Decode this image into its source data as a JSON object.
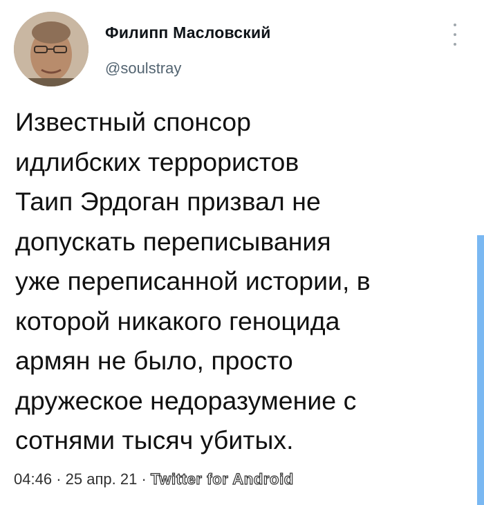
{
  "tweet": {
    "author_name": "Филипп Масловский",
    "author_handle": "@soulstray",
    "text_lines": [
      "Известный спонсор",
      "идлибских террористов",
      "Таип Эрдоган призвал не",
      "допускать переписывания",
      "уже переписанной истории, в",
      "которой никакого геноцида",
      "армян не было, просто",
      "дружеское недоразумение с",
      "сотнями тысяч убитых."
    ],
    "time": "04:46",
    "separator": "·",
    "date": "25 апр. 21",
    "source": "Twitter for Android"
  },
  "icons": {
    "more": "more-vertical-icon",
    "avatar": "avatar"
  },
  "colors": {
    "text": "#111111",
    "handle": "#536471",
    "scroll_indicator": "#7ab8f2"
  }
}
